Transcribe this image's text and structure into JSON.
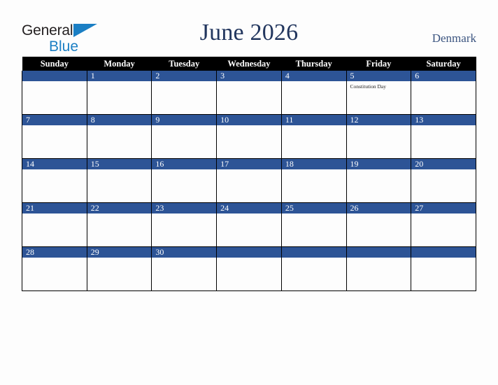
{
  "brand": {
    "word1": "General",
    "word2": "Blue",
    "triangle_color": "#1b7fc4",
    "word1_color": "#231f20"
  },
  "header": {
    "title": "June 2026",
    "country": "Denmark",
    "title_color": "#22365e",
    "country_color": "#3c5580"
  },
  "calendar": {
    "weekday_headers": [
      "Sunday",
      "Monday",
      "Tuesday",
      "Wednesday",
      "Thursday",
      "Friday",
      "Saturday"
    ],
    "header_bg": "#000000",
    "header_fg": "#ffffff",
    "daynum_bg": "#2d5496",
    "daynum_fg": "#ffffff",
    "cell_bg": "#fdfdfd",
    "grid_color": "#000000",
    "weeks": [
      [
        {
          "day": "",
          "events": []
        },
        {
          "day": "1",
          "events": []
        },
        {
          "day": "2",
          "events": []
        },
        {
          "day": "3",
          "events": []
        },
        {
          "day": "4",
          "events": []
        },
        {
          "day": "5",
          "events": [
            "Constitution Day"
          ]
        },
        {
          "day": "6",
          "events": []
        }
      ],
      [
        {
          "day": "7",
          "events": []
        },
        {
          "day": "8",
          "events": []
        },
        {
          "day": "9",
          "events": []
        },
        {
          "day": "10",
          "events": []
        },
        {
          "day": "11",
          "events": []
        },
        {
          "day": "12",
          "events": []
        },
        {
          "day": "13",
          "events": []
        }
      ],
      [
        {
          "day": "14",
          "events": []
        },
        {
          "day": "15",
          "events": []
        },
        {
          "day": "16",
          "events": []
        },
        {
          "day": "17",
          "events": []
        },
        {
          "day": "18",
          "events": []
        },
        {
          "day": "19",
          "events": []
        },
        {
          "day": "20",
          "events": []
        }
      ],
      [
        {
          "day": "21",
          "events": []
        },
        {
          "day": "22",
          "events": []
        },
        {
          "day": "23",
          "events": []
        },
        {
          "day": "24",
          "events": []
        },
        {
          "day": "25",
          "events": []
        },
        {
          "day": "26",
          "events": []
        },
        {
          "day": "27",
          "events": []
        }
      ],
      [
        {
          "day": "28",
          "events": []
        },
        {
          "day": "29",
          "events": []
        },
        {
          "day": "30",
          "events": []
        },
        {
          "day": "",
          "events": []
        },
        {
          "day": "",
          "events": []
        },
        {
          "day": "",
          "events": []
        },
        {
          "day": "",
          "events": []
        }
      ]
    ]
  }
}
